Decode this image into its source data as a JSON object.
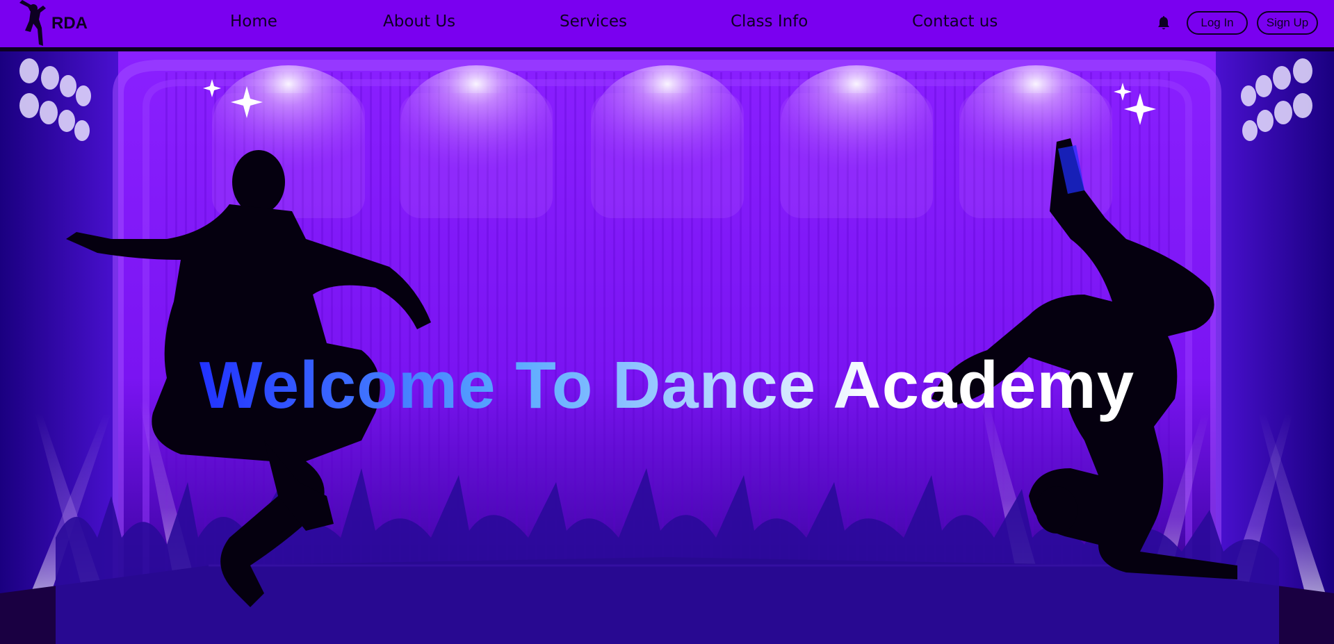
{
  "brand": {
    "name": "RDA",
    "logo_icon": "dancer-logo-icon"
  },
  "nav": {
    "items": [
      {
        "label": "Home"
      },
      {
        "label": "About Us"
      },
      {
        "label": "Services"
      },
      {
        "label": "Class Info"
      },
      {
        "label": "Contact us"
      }
    ]
  },
  "actions": {
    "notification_icon": "bell-icon",
    "login_label": "Log In",
    "signup_label": "Sign Up"
  },
  "hero": {
    "title": "Welcome To Dance Academy",
    "background": "stage-with-dancers-and-crowd"
  },
  "colors": {
    "navbar": "#7a00f0",
    "nav_text": "#0d0022",
    "stage_purple": "#8a1aff",
    "title_gradient_start": "#1f2dff",
    "title_gradient_end": "#ffffff"
  }
}
